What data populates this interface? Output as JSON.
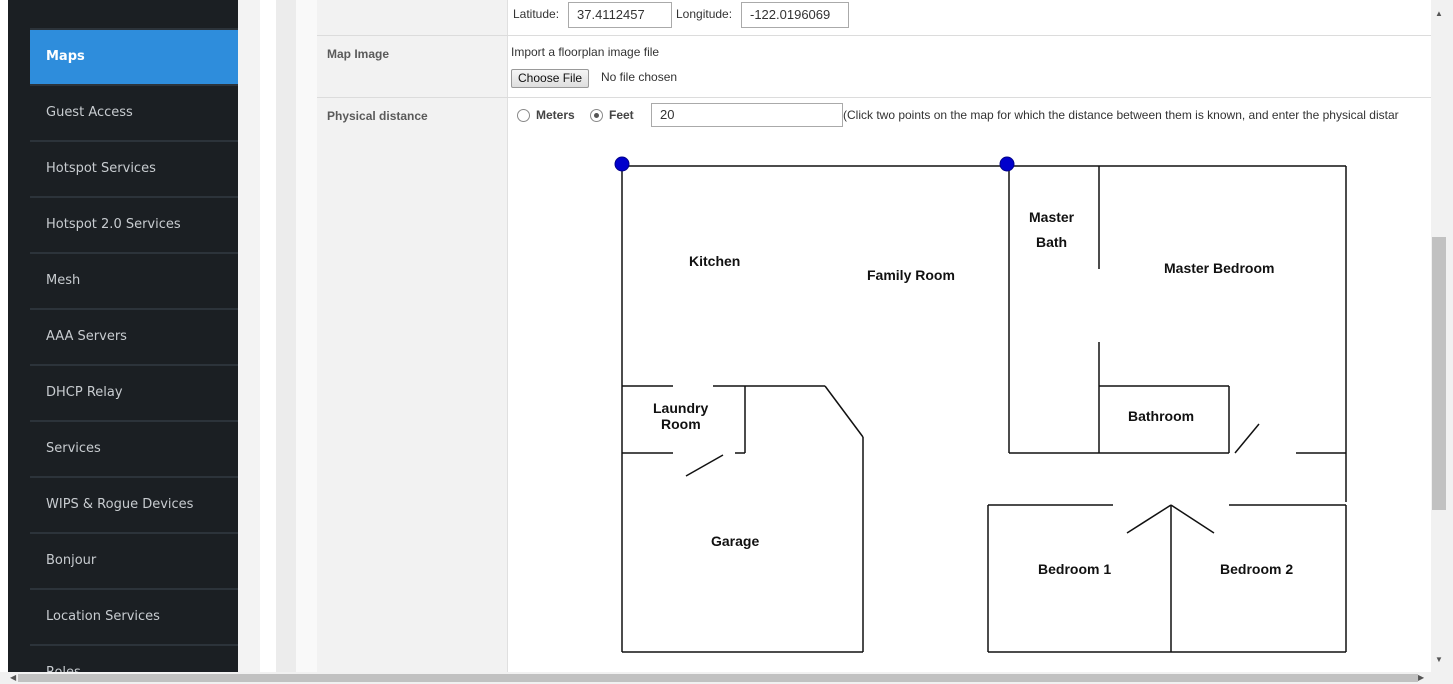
{
  "sidebar": {
    "items": [
      {
        "label": "Maps",
        "active": true
      },
      {
        "label": "Guest Access"
      },
      {
        "label": "Hotspot Services"
      },
      {
        "label": "Hotspot 2.0 Services"
      },
      {
        "label": "Mesh"
      },
      {
        "label": "AAA Servers"
      },
      {
        "label": "DHCP Relay"
      },
      {
        "label": "Services"
      },
      {
        "label": "WIPS & Rogue Devices"
      },
      {
        "label": "Bonjour"
      },
      {
        "label": "Location Services"
      },
      {
        "label": "Roles"
      }
    ]
  },
  "location": {
    "latitude_label": "Latitude:",
    "latitude_value": "37.4112457",
    "longitude_label": "Longitude:",
    "longitude_value": "-122.0196069"
  },
  "map_image": {
    "label": "Map Image",
    "hint": "Import a floorplan image file",
    "choose_button": "Choose File",
    "file_status": "No file chosen"
  },
  "physical_distance": {
    "label": "Physical distance",
    "unit_meters": "Meters",
    "unit_feet": "Feet",
    "selected_unit": "Feet",
    "value": "20",
    "instructions": "(Click two points on the map for which the distance between them is known, and enter the physical distar"
  },
  "floorplan": {
    "rooms": {
      "kitchen": "Kitchen",
      "family_room": "Family Room",
      "master_bath_1": "Master",
      "master_bath_2": "Bath",
      "master_bedroom": "Master Bedroom",
      "laundry_1": "Laundry",
      "laundry_2": "Room",
      "bathroom": "Bathroom",
      "garage": "Garage",
      "bedroom1": "Bedroom 1",
      "bedroom2": "Bedroom 2"
    },
    "marker_color": "#0000cc"
  },
  "colors": {
    "sidebar_bg": "#1b1f23",
    "sidebar_active": "#2e8ddc"
  }
}
